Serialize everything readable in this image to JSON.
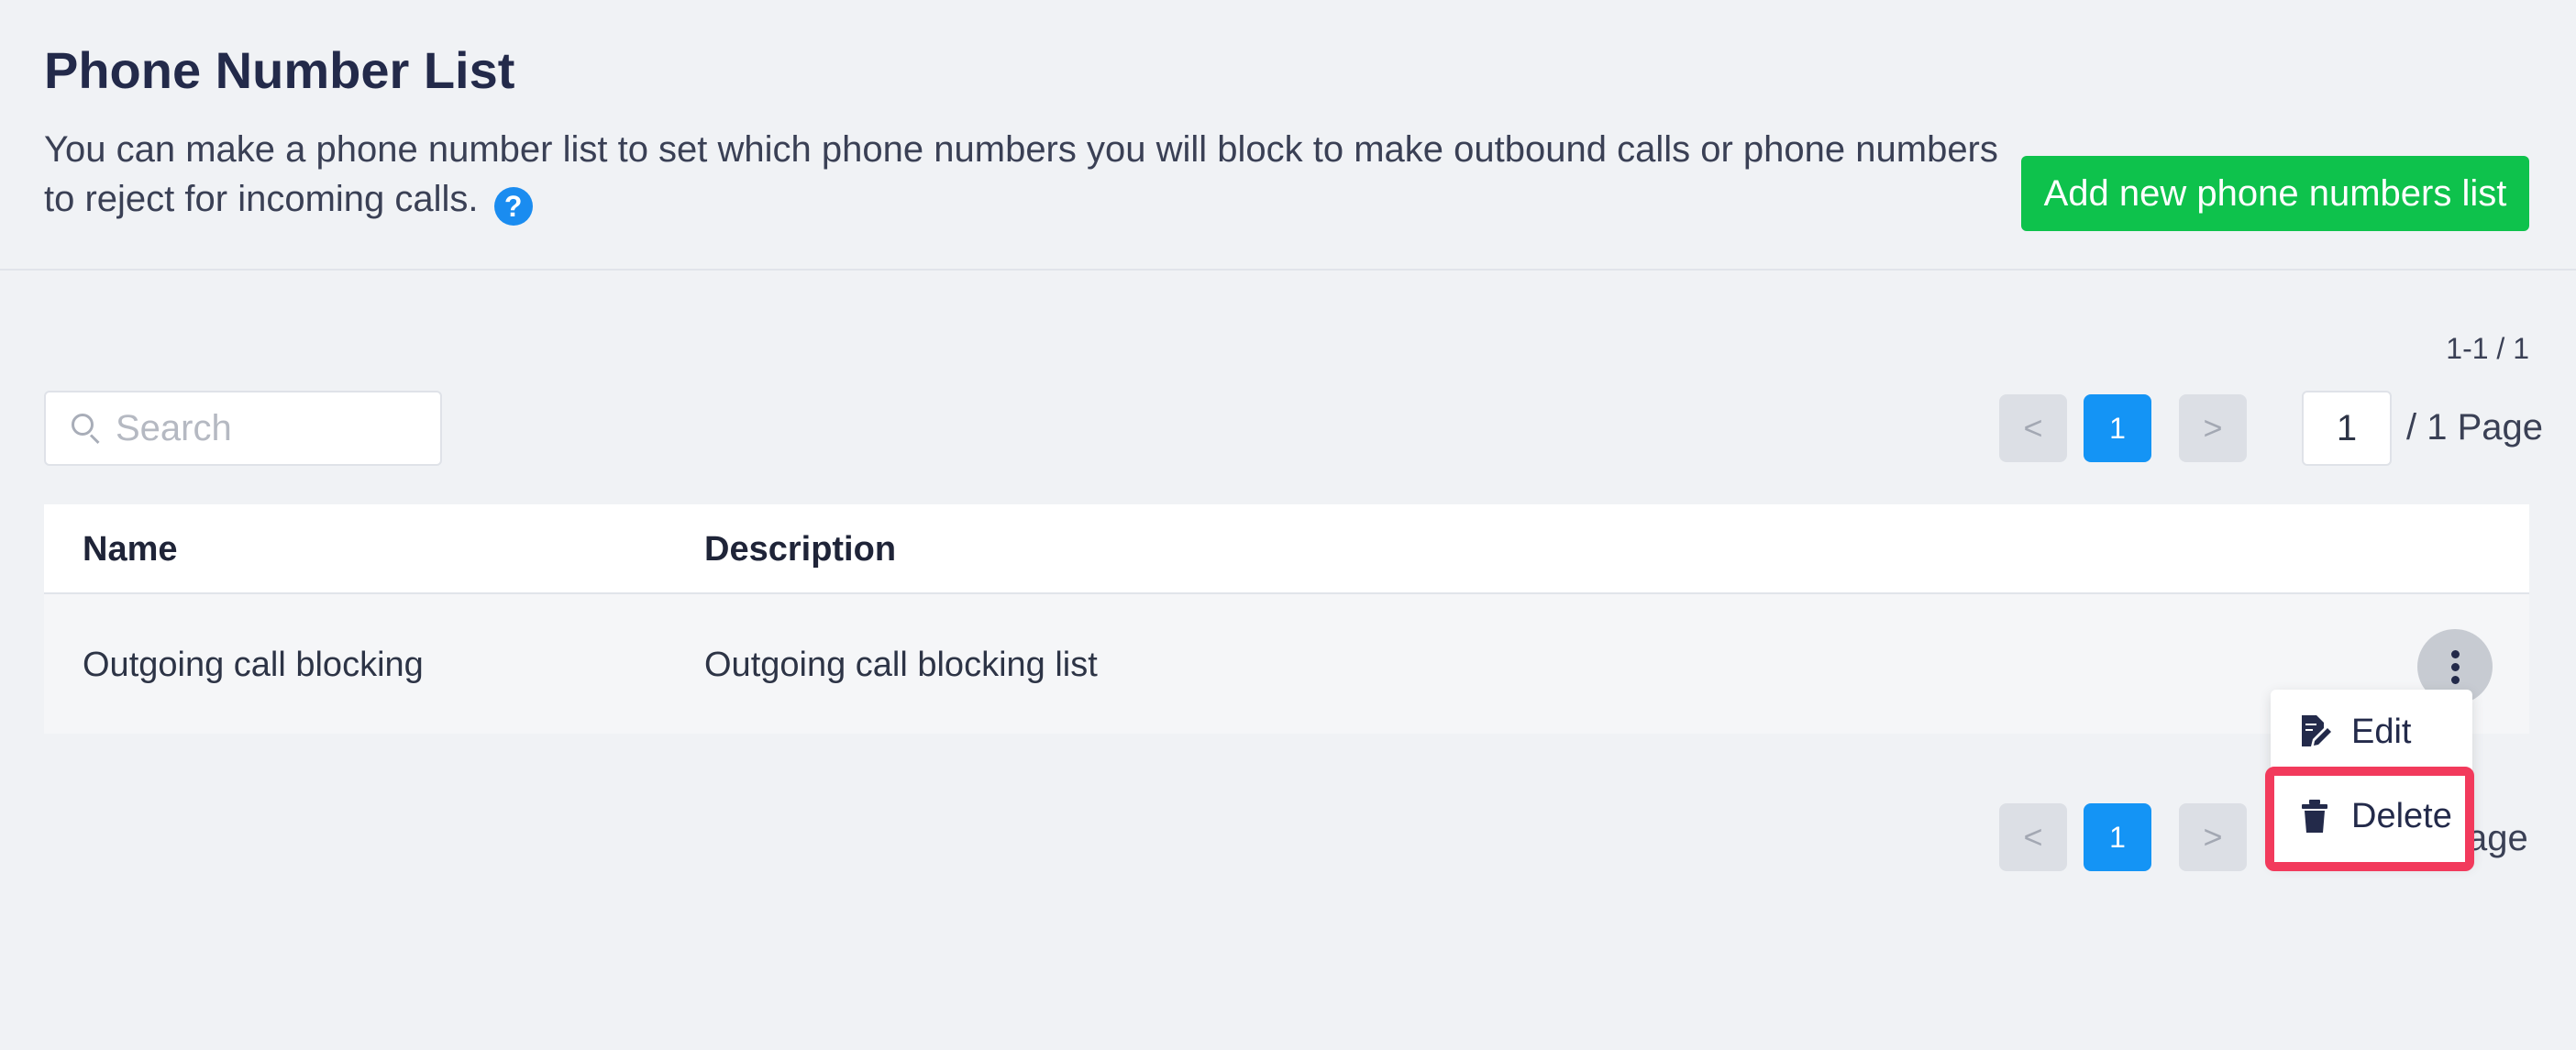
{
  "header": {
    "title": "Phone Number List",
    "description": "You can make a phone number list to set which phone numbers you will block to make outbound calls or phone numbers to reject for incoming calls.",
    "help_icon": "?",
    "add_button_label": "Add new phone numbers list"
  },
  "toolbar": {
    "range_count": "1-1 / 1",
    "search_placeholder": "Search",
    "prev_symbol": "<",
    "next_symbol": ">",
    "current_page": "1",
    "page_input_value": "1",
    "page_suffix": "/ 1 Page"
  },
  "table": {
    "columns": [
      "Name",
      "Description"
    ],
    "rows": [
      {
        "name": "Outgoing call blocking",
        "description": "Outgoing call blocking list"
      }
    ]
  },
  "row_menu": {
    "items": [
      {
        "label": "Edit",
        "icon": "edit-icon"
      },
      {
        "label": "Delete",
        "icon": "trash-icon"
      }
    ]
  },
  "bottom_pagination": {
    "prev_symbol": "<",
    "next_symbol": ">",
    "current_page": "1",
    "visible_suffix": "age"
  },
  "colors": {
    "add_button": "#0ec24c",
    "current_page": "#1494f5",
    "highlight": "#f23a5c"
  }
}
